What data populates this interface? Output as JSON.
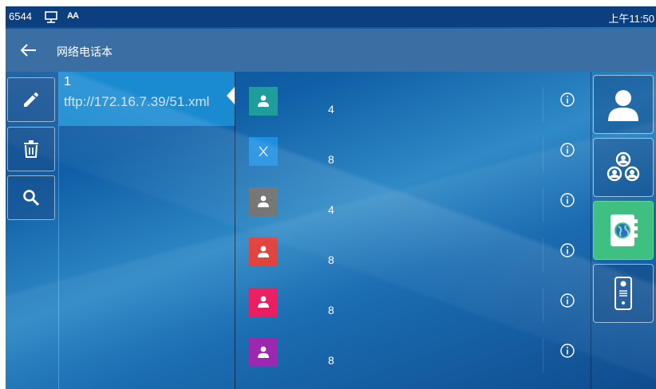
{
  "status": {
    "ext": "6544",
    "font_glyph": "AΑ",
    "time": "上午11:50"
  },
  "header": {
    "title": "网络电话本"
  },
  "directory": {
    "index": "1",
    "url": "tftp://172.16.7.39/51.xml"
  },
  "contacts": [
    {
      "name": "4",
      "avatar_color": "#1f9c9c",
      "icon": "person-icon"
    },
    {
      "name": "8",
      "avatar_color": "#1e8fe0",
      "icon": "x-icon"
    },
    {
      "name": "4",
      "avatar_color": "#6e6e6e",
      "icon": "person-icon"
    },
    {
      "name": "8",
      "avatar_color": "#e03c36",
      "icon": "person-icon"
    },
    {
      "name": "8",
      "avatar_color": "#e91e63",
      "icon": "person-icon"
    },
    {
      "name": "8",
      "avatar_color": "#9c27b0",
      "icon": "person-icon"
    }
  ],
  "colors": {
    "active_nav": "#3fbf82",
    "status_bar": "#0b3f80",
    "title_bar": "#3b6fa4"
  }
}
